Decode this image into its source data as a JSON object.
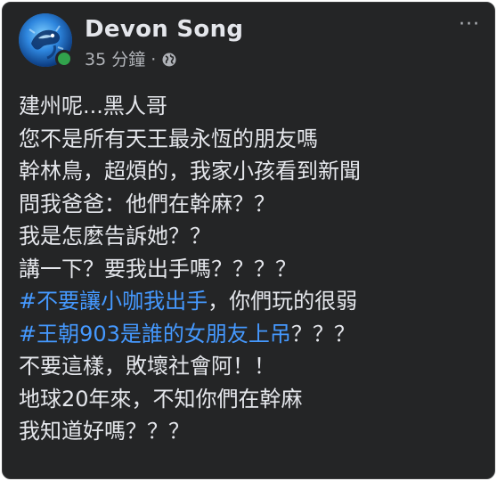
{
  "post": {
    "author": "Devon Song",
    "time": "35 分鐘",
    "separator": "·",
    "privacy_icon": "globe-icon",
    "more_icon": "more-options-icon",
    "more_label": "···",
    "avatar_icon": "avatar-image",
    "lines": [
      {
        "hashtag": "",
        "text": "建州呢...黑人哥"
      },
      {
        "hashtag": "",
        "text": "您不是所有天王最永恆的朋友嗎"
      },
      {
        "hashtag": "",
        "text": "幹林鳥，超煩的，我家小孩看到新聞"
      },
      {
        "hashtag": "",
        "text": "問我爸爸：他們在幹麻？？"
      },
      {
        "hashtag": "",
        "text": "我是怎麼告訴她？？"
      },
      {
        "hashtag": "",
        "text": "講一下？要我出手嗎？？？？"
      },
      {
        "hashtag": "#不要讓小咖我出手",
        "text": "，你們玩的很弱"
      },
      {
        "hashtag": "#王朝903是誰的女朋友上吊",
        "text": "？？？"
      },
      {
        "hashtag": "",
        "text": "不要這樣，敗壞社會阿！！"
      },
      {
        "hashtag": "",
        "text": "地球20年來，不知你們在幹麻"
      },
      {
        "hashtag": "",
        "text": "我知道好嗎？？？"
      }
    ]
  },
  "colors": {
    "card_background": "#242526",
    "text_primary": "#e4e6eb",
    "text_secondary": "#b0b3b8",
    "hashtag": "#4599ff",
    "online": "#31a24c"
  }
}
